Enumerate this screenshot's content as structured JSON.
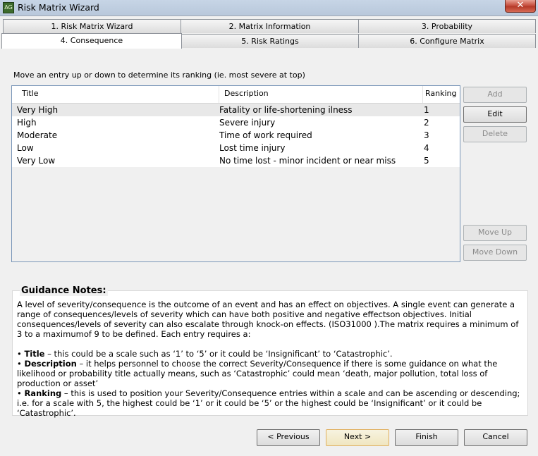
{
  "window": {
    "title": "Risk Matrix Wizard",
    "icon_text": "AG",
    "close_glyph": "✕"
  },
  "tabs": [
    {
      "label": "1. Risk Matrix Wizard",
      "active": false
    },
    {
      "label": "2. Matrix Information",
      "active": false
    },
    {
      "label": "3. Probability",
      "active": false
    },
    {
      "label": "4. Consequence",
      "active": true
    },
    {
      "label": "5. Risk Ratings",
      "active": false
    },
    {
      "label": "6. Configure Matrix",
      "active": false
    }
  ],
  "instruction": "Move an entry up or down to determine its ranking (ie. most severe at top)",
  "grid": {
    "columns": [
      "Title",
      "Description",
      "Ranking"
    ],
    "rows": [
      {
        "title": "Very High",
        "description": "Fatality or life-shortening ilness",
        "ranking": "1"
      },
      {
        "title": "High",
        "description": "Severe injury",
        "ranking": "2"
      },
      {
        "title": "Moderate",
        "description": "Time of work required",
        "ranking": "3"
      },
      {
        "title": "Low",
        "description": "Lost time injury",
        "ranking": "4"
      },
      {
        "title": "Very Low",
        "description": "No time lost - minor incident or near miss",
        "ranking": "5"
      }
    ]
  },
  "side_buttons": {
    "add": "Add",
    "edit": "Edit",
    "delete": "Delete",
    "move_up": "Move Up",
    "move_down": "Move Down"
  },
  "guidance": {
    "title": "Guidance Notes:",
    "paragraph": "A level of severity/consequence is the outcome of an event and has an effect on objectives. A single event can generate a range of consequences/levels of severity which can have both positive and negative effectson objectives. Initial consequences/levels of severity can also escalate through knock-on effects. (ISO31000 ).The matrix requires a minimum of 3 to a maximumof 9 to be defined. Each entry requires a:",
    "bullets": [
      {
        "term": "Title",
        "text": " – this could be a scale such as ‘1’ to ‘5’ or it could be ‘Insignificant’ to ‘Catastrophic’."
      },
      {
        "term": "Description",
        "text": " – it helps personnel to choose the correct Severity/Consequence if there is some guidance on what the likelihood or probability title actually means, such as ‘Catastrophic’ could mean ‘death, major pollution, total loss of production or asset’"
      },
      {
        "term": "Ranking",
        "text": " – this is used to position your Severity/Consequence entries within a scale and can be ascending or descending; i.e. for a scale with 5, the highest could be ‘1’ or it could be ‘5’ or the highest could be ‘Insignificant’ or it could be ‘Catastrophic’."
      }
    ]
  },
  "footer": {
    "previous": "< Previous",
    "next": "Next >",
    "finish": "Finish",
    "cancel": "Cancel"
  }
}
